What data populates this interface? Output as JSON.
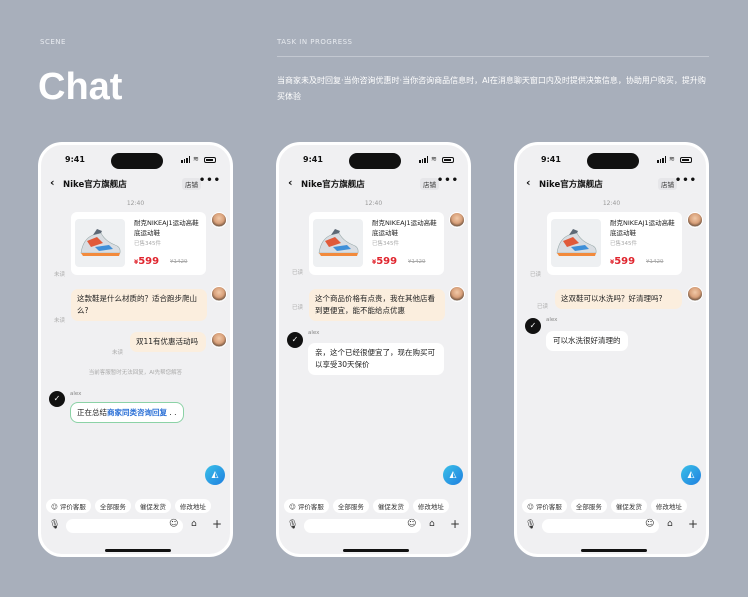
{
  "scene_label": "SCENE",
  "task_label": "TASK IN PROGRESS",
  "title": "Chat",
  "description": "当商家未及时回复·当你咨询优惠时·当你咨询商品信息时，AI在消息聊天窗口内及时提供决策信息，协助用户购买，提升购买体验",
  "status_time": "9:41",
  "nav": {
    "shop_name": "Nike官方旗舰店",
    "store_button": "店铺",
    "more": "•••"
  },
  "timestamp": "12:40",
  "product": {
    "name": "耐克NIKEAJ1运动高鞋底运动鞋",
    "sold": "已售345件",
    "price_symbol": "¥",
    "price": "599",
    "old_price": "¥1429"
  },
  "phones": [
    {
      "read_status": "未读",
      "read_status_2": "未读",
      "question": "这款鞋是什么材质的？适合跑步爬山么?",
      "question2": "双11有优惠活动吗",
      "read_status_3": "未读",
      "system_note": "当前客服暂时无法回复，AI先帮您解答",
      "sender": "alex",
      "ai_prefix": "正在总结",
      "ai_highlight": "商家同类咨询回复",
      "ai_suffix": " . ."
    },
    {
      "read_status": "已读",
      "read_status_2": "已读",
      "question": "这个商品价格有点贵，我在其他店看到更便宜，能不能给点优惠",
      "sender": "alex",
      "answer": "亲，这个已经很便宜了，现在购买可以享受30天保价"
    },
    {
      "read_status": "已读",
      "read_status_2": "已读",
      "question": "这双鞋可以水洗吗？好清理吗?",
      "sender": "alex",
      "answer": "可以水洗很好清理的"
    }
  ],
  "quick_actions": [
    "评价客服",
    "全部服务",
    "催促发货",
    "修改地址"
  ],
  "icons": {
    "back": "chevron-left-icon",
    "mic": "mic-icon",
    "emoji": "emoji-icon",
    "bag": "bag-icon",
    "plus": "plus-icon",
    "ai": "ai-assistant-icon"
  },
  "colors": {
    "background": "#a8afbb",
    "price": "#e0262f",
    "highlight": "#2a6fd6",
    "bubble_out": "#fbeede"
  }
}
